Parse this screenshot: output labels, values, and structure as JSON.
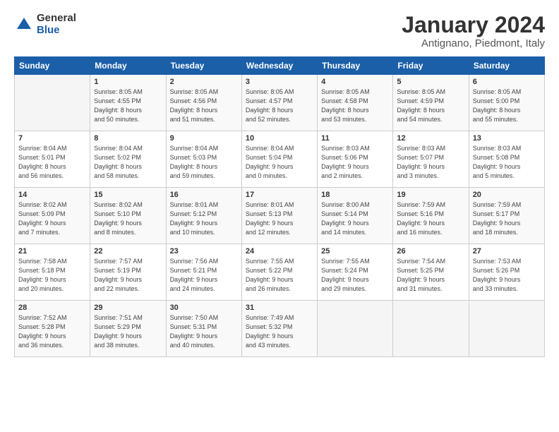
{
  "logo": {
    "general": "General",
    "blue": "Blue"
  },
  "header": {
    "month": "January 2024",
    "location": "Antignano, Piedmont, Italy"
  },
  "days_of_week": [
    "Sunday",
    "Monday",
    "Tuesday",
    "Wednesday",
    "Thursday",
    "Friday",
    "Saturday"
  ],
  "weeks": [
    [
      {
        "num": "",
        "info": ""
      },
      {
        "num": "1",
        "info": "Sunrise: 8:05 AM\nSunset: 4:55 PM\nDaylight: 8 hours\nand 50 minutes."
      },
      {
        "num": "2",
        "info": "Sunrise: 8:05 AM\nSunset: 4:56 PM\nDaylight: 8 hours\nand 51 minutes."
      },
      {
        "num": "3",
        "info": "Sunrise: 8:05 AM\nSunset: 4:57 PM\nDaylight: 8 hours\nand 52 minutes."
      },
      {
        "num": "4",
        "info": "Sunrise: 8:05 AM\nSunset: 4:58 PM\nDaylight: 8 hours\nand 53 minutes."
      },
      {
        "num": "5",
        "info": "Sunrise: 8:05 AM\nSunset: 4:59 PM\nDaylight: 8 hours\nand 54 minutes."
      },
      {
        "num": "6",
        "info": "Sunrise: 8:05 AM\nSunset: 5:00 PM\nDaylight: 8 hours\nand 55 minutes."
      }
    ],
    [
      {
        "num": "7",
        "info": "Sunrise: 8:04 AM\nSunset: 5:01 PM\nDaylight: 8 hours\nand 56 minutes."
      },
      {
        "num": "8",
        "info": "Sunrise: 8:04 AM\nSunset: 5:02 PM\nDaylight: 8 hours\nand 58 minutes."
      },
      {
        "num": "9",
        "info": "Sunrise: 8:04 AM\nSunset: 5:03 PM\nDaylight: 8 hours\nand 59 minutes."
      },
      {
        "num": "10",
        "info": "Sunrise: 8:04 AM\nSunset: 5:04 PM\nDaylight: 9 hours\nand 0 minutes."
      },
      {
        "num": "11",
        "info": "Sunrise: 8:03 AM\nSunset: 5:06 PM\nDaylight: 9 hours\nand 2 minutes."
      },
      {
        "num": "12",
        "info": "Sunrise: 8:03 AM\nSunset: 5:07 PM\nDaylight: 9 hours\nand 3 minutes."
      },
      {
        "num": "13",
        "info": "Sunrise: 8:03 AM\nSunset: 5:08 PM\nDaylight: 9 hours\nand 5 minutes."
      }
    ],
    [
      {
        "num": "14",
        "info": "Sunrise: 8:02 AM\nSunset: 5:09 PM\nDaylight: 9 hours\nand 7 minutes."
      },
      {
        "num": "15",
        "info": "Sunrise: 8:02 AM\nSunset: 5:10 PM\nDaylight: 9 hours\nand 8 minutes."
      },
      {
        "num": "16",
        "info": "Sunrise: 8:01 AM\nSunset: 5:12 PM\nDaylight: 9 hours\nand 10 minutes."
      },
      {
        "num": "17",
        "info": "Sunrise: 8:01 AM\nSunset: 5:13 PM\nDaylight: 9 hours\nand 12 minutes."
      },
      {
        "num": "18",
        "info": "Sunrise: 8:00 AM\nSunset: 5:14 PM\nDaylight: 9 hours\nand 14 minutes."
      },
      {
        "num": "19",
        "info": "Sunrise: 7:59 AM\nSunset: 5:16 PM\nDaylight: 9 hours\nand 16 minutes."
      },
      {
        "num": "20",
        "info": "Sunrise: 7:59 AM\nSunset: 5:17 PM\nDaylight: 9 hours\nand 18 minutes."
      }
    ],
    [
      {
        "num": "21",
        "info": "Sunrise: 7:58 AM\nSunset: 5:18 PM\nDaylight: 9 hours\nand 20 minutes."
      },
      {
        "num": "22",
        "info": "Sunrise: 7:57 AM\nSunset: 5:19 PM\nDaylight: 9 hours\nand 22 minutes."
      },
      {
        "num": "23",
        "info": "Sunrise: 7:56 AM\nSunset: 5:21 PM\nDaylight: 9 hours\nand 24 minutes."
      },
      {
        "num": "24",
        "info": "Sunrise: 7:55 AM\nSunset: 5:22 PM\nDaylight: 9 hours\nand 26 minutes."
      },
      {
        "num": "25",
        "info": "Sunrise: 7:55 AM\nSunset: 5:24 PM\nDaylight: 9 hours\nand 29 minutes."
      },
      {
        "num": "26",
        "info": "Sunrise: 7:54 AM\nSunset: 5:25 PM\nDaylight: 9 hours\nand 31 minutes."
      },
      {
        "num": "27",
        "info": "Sunrise: 7:53 AM\nSunset: 5:26 PM\nDaylight: 9 hours\nand 33 minutes."
      }
    ],
    [
      {
        "num": "28",
        "info": "Sunrise: 7:52 AM\nSunset: 5:28 PM\nDaylight: 9 hours\nand 36 minutes."
      },
      {
        "num": "29",
        "info": "Sunrise: 7:51 AM\nSunset: 5:29 PM\nDaylight: 9 hours\nand 38 minutes."
      },
      {
        "num": "30",
        "info": "Sunrise: 7:50 AM\nSunset: 5:31 PM\nDaylight: 9 hours\nand 40 minutes."
      },
      {
        "num": "31",
        "info": "Sunrise: 7:49 AM\nSunset: 5:32 PM\nDaylight: 9 hours\nand 43 minutes."
      },
      {
        "num": "",
        "info": ""
      },
      {
        "num": "",
        "info": ""
      },
      {
        "num": "",
        "info": ""
      }
    ]
  ]
}
